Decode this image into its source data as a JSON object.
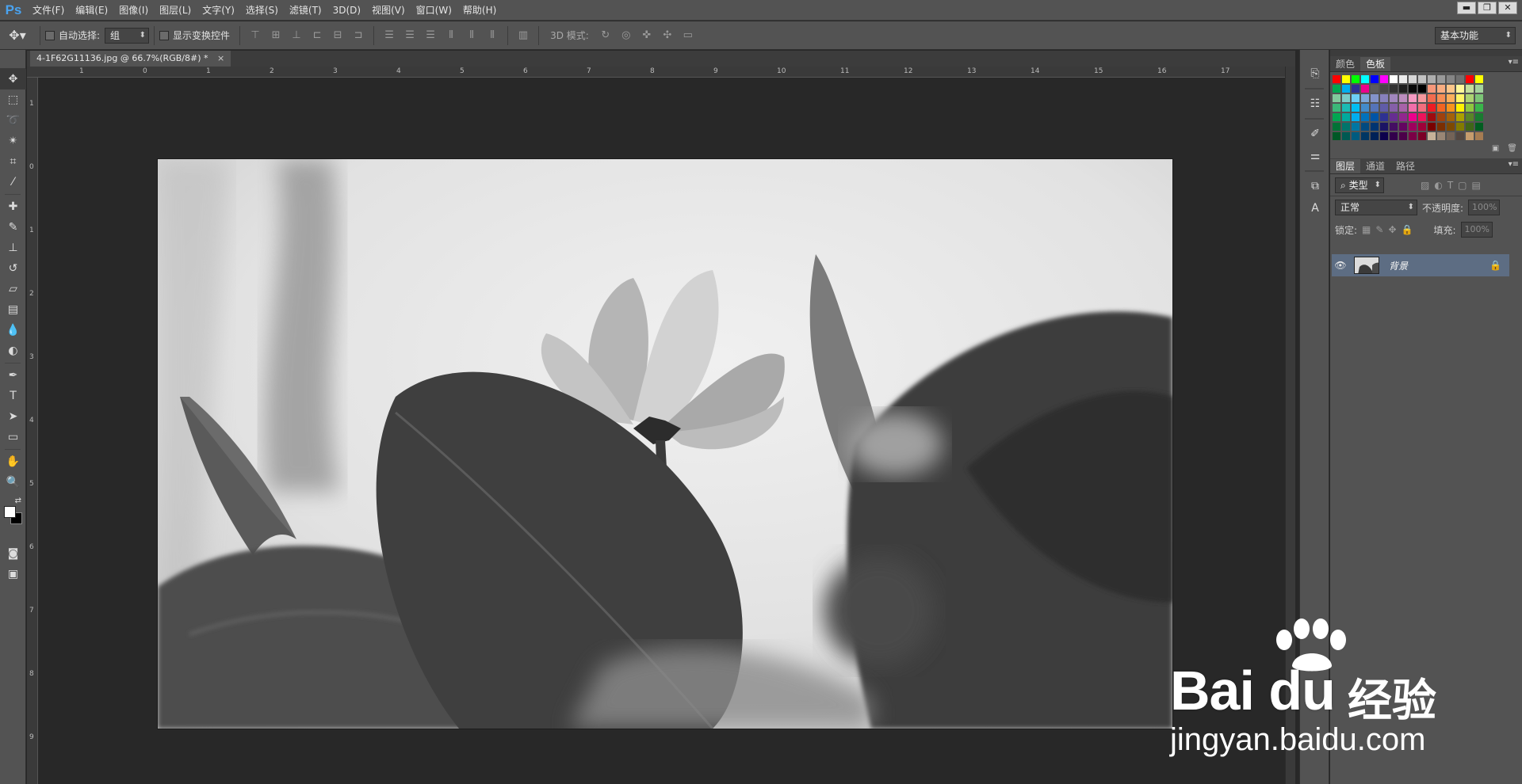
{
  "app": {
    "logo": "Ps"
  },
  "menu": [
    "文件(F)",
    "编辑(E)",
    "图像(I)",
    "图层(L)",
    "文字(Y)",
    "选择(S)",
    "滤镜(T)",
    "3D(D)",
    "视图(V)",
    "窗口(W)",
    "帮助(H)"
  ],
  "window_controls": {
    "minimize": "▬",
    "restore": "❐",
    "close": "✕"
  },
  "options": {
    "auto_select_label": "自动选择:",
    "auto_select_value": "组",
    "show_transform_label": "显示变换控件",
    "mode_3d_label": "3D 模式:",
    "workspace": "基本功能"
  },
  "document": {
    "tab_title": "4-1F62G11136.jpg @ 66.7%(RGB/8#) *",
    "close_glyph": "×"
  },
  "ruler": {
    "h_labels": [
      "1",
      "0",
      "1",
      "2",
      "3",
      "4",
      "5",
      "6",
      "7",
      "8",
      "9",
      "10",
      "11",
      "12",
      "13",
      "14",
      "15",
      "16",
      "17"
    ],
    "v_labels": [
      "1",
      "0",
      "1",
      "2",
      "3",
      "4",
      "5",
      "6",
      "7",
      "8",
      "9"
    ]
  },
  "panels": {
    "color_tabs": [
      "颜色",
      "色板"
    ],
    "active_color_tab": "色板",
    "menu_glyph": "▾≡",
    "layers_tabs": [
      "图层",
      "通道",
      "路径"
    ],
    "filter_kind": "类型",
    "blend_mode": "正常",
    "opacity_label": "不透明度:",
    "opacity_value": "100%",
    "lock_label": "锁定:",
    "fill_label": "填充:",
    "fill_value": "100%",
    "layer": {
      "name": "背景"
    }
  },
  "swatches": [
    [
      "#ff0000",
      "#ffff00",
      "#00ff00",
      "#00ffff",
      "#0000ff",
      "#ff00ff",
      "#ffffff",
      "#ebebeb",
      "#d6d6d6",
      "#c2c2c2",
      "#adadad",
      "#999999",
      "#858585",
      "#707070",
      "#ff0000",
      "#ffff00"
    ],
    [
      "#00a651",
      "#00aeef",
      "#2e3192",
      "#ec008c",
      "#5c5c5c",
      "#474747",
      "#333333",
      "#1f1f1f",
      "#0a0a0a",
      "#000000",
      "#f7977a",
      "#f9ad81",
      "#fdc68a",
      "#fff79a",
      "#c4df9b",
      "#a3d39c"
    ],
    [
      "#82ca9c",
      "#7accc8",
      "#6dcff6",
      "#7da7d9",
      "#8393ca",
      "#8781bd",
      "#a187be",
      "#bc8dbf",
      "#f49ac2",
      "#f6989d",
      "#f26c4f",
      "#f68e55",
      "#fbaf5c",
      "#fff467",
      "#acd372",
      "#7cc576"
    ],
    [
      "#3bb878",
      "#1abbb4",
      "#00bff3",
      "#438ccb",
      "#5574b9",
      "#605ca8",
      "#855fa8",
      "#a763a8",
      "#f06ea9",
      "#f26d7d",
      "#ed1c24",
      "#f26522",
      "#f7941d",
      "#fff200",
      "#8dc73f",
      "#39b54a"
    ],
    [
      "#00a651",
      "#00a99d",
      "#00aeef",
      "#0072bc",
      "#0054a6",
      "#2e3192",
      "#662d91",
      "#92278f",
      "#ec008c",
      "#ed145b",
      "#9e0b0f",
      "#a0410d",
      "#a36209",
      "#aba000",
      "#598527",
      "#197b30"
    ],
    [
      "#007236",
      "#00746b",
      "#0076a3",
      "#004a80",
      "#003471",
      "#1b1464",
      "#440e62",
      "#630460",
      "#9e005d",
      "#9e0039",
      "#790000",
      "#7b2e00",
      "#7d4900",
      "#827b00",
      "#406618",
      "#005e20"
    ],
    [
      "#005826",
      "#005952",
      "#005b7f",
      "#003663",
      "#002157",
      "#0d004c",
      "#32004b",
      "#4b0049",
      "#7b0046",
      "#7a0026",
      "#c7b299",
      "#998675",
      "#736357",
      "#534741",
      "#c69c6d",
      "#a67c52"
    ]
  ]
}
